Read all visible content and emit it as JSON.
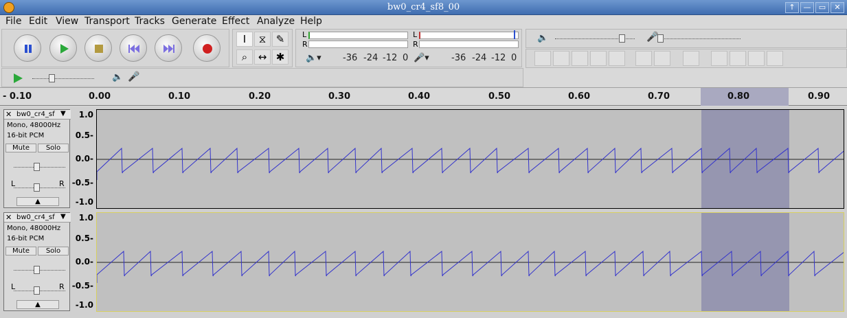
{
  "window": {
    "title": "bw0_cr4_sf8_00",
    "buttons": [
      "↑",
      "—",
      "▭",
      "✕"
    ]
  },
  "menu": [
    "File",
    "Edit",
    "View",
    "Transport",
    "Tracks",
    "Generate",
    "Effect",
    "Analyze",
    "Help"
  ],
  "meter": {
    "left_label": "L",
    "right_label": "R",
    "scale": [
      "-36",
      "-24",
      "-12",
      "0"
    ]
  },
  "ruler": {
    "labels": [
      "- 0.10",
      "0.00",
      "0.10",
      "0.20",
      "0.30",
      "0.40",
      "0.50",
      "0.60",
      "0.70",
      "0.80",
      "0.90"
    ]
  },
  "tracks": [
    {
      "name": "bw0_cr4_sf",
      "format": "Mono, 48000Hz",
      "bits": "16-bit PCM",
      "mute": "Mute",
      "solo": "Solo",
      "pan_l": "L",
      "pan_r": "R",
      "scale": [
        "1.0",
        "0.5-",
        "0.0-",
        "-0.5-",
        "-1.0"
      ]
    },
    {
      "name": "bw0_cr4_sf",
      "format": "Mono, 48000Hz",
      "bits": "16-bit PCM",
      "mute": "Mute",
      "solo": "Solo",
      "pan_l": "L",
      "pan_r": "R",
      "scale": [
        "1.0",
        "0.5-",
        "0.0-",
        "-0.5-",
        "-1.0"
      ]
    }
  ],
  "selection": {
    "start": 0.755,
    "end": 0.866
  },
  "colors": {
    "waveform": "#3333cc",
    "selection": "#9696b0",
    "titlebar": "#4f7cc0"
  }
}
